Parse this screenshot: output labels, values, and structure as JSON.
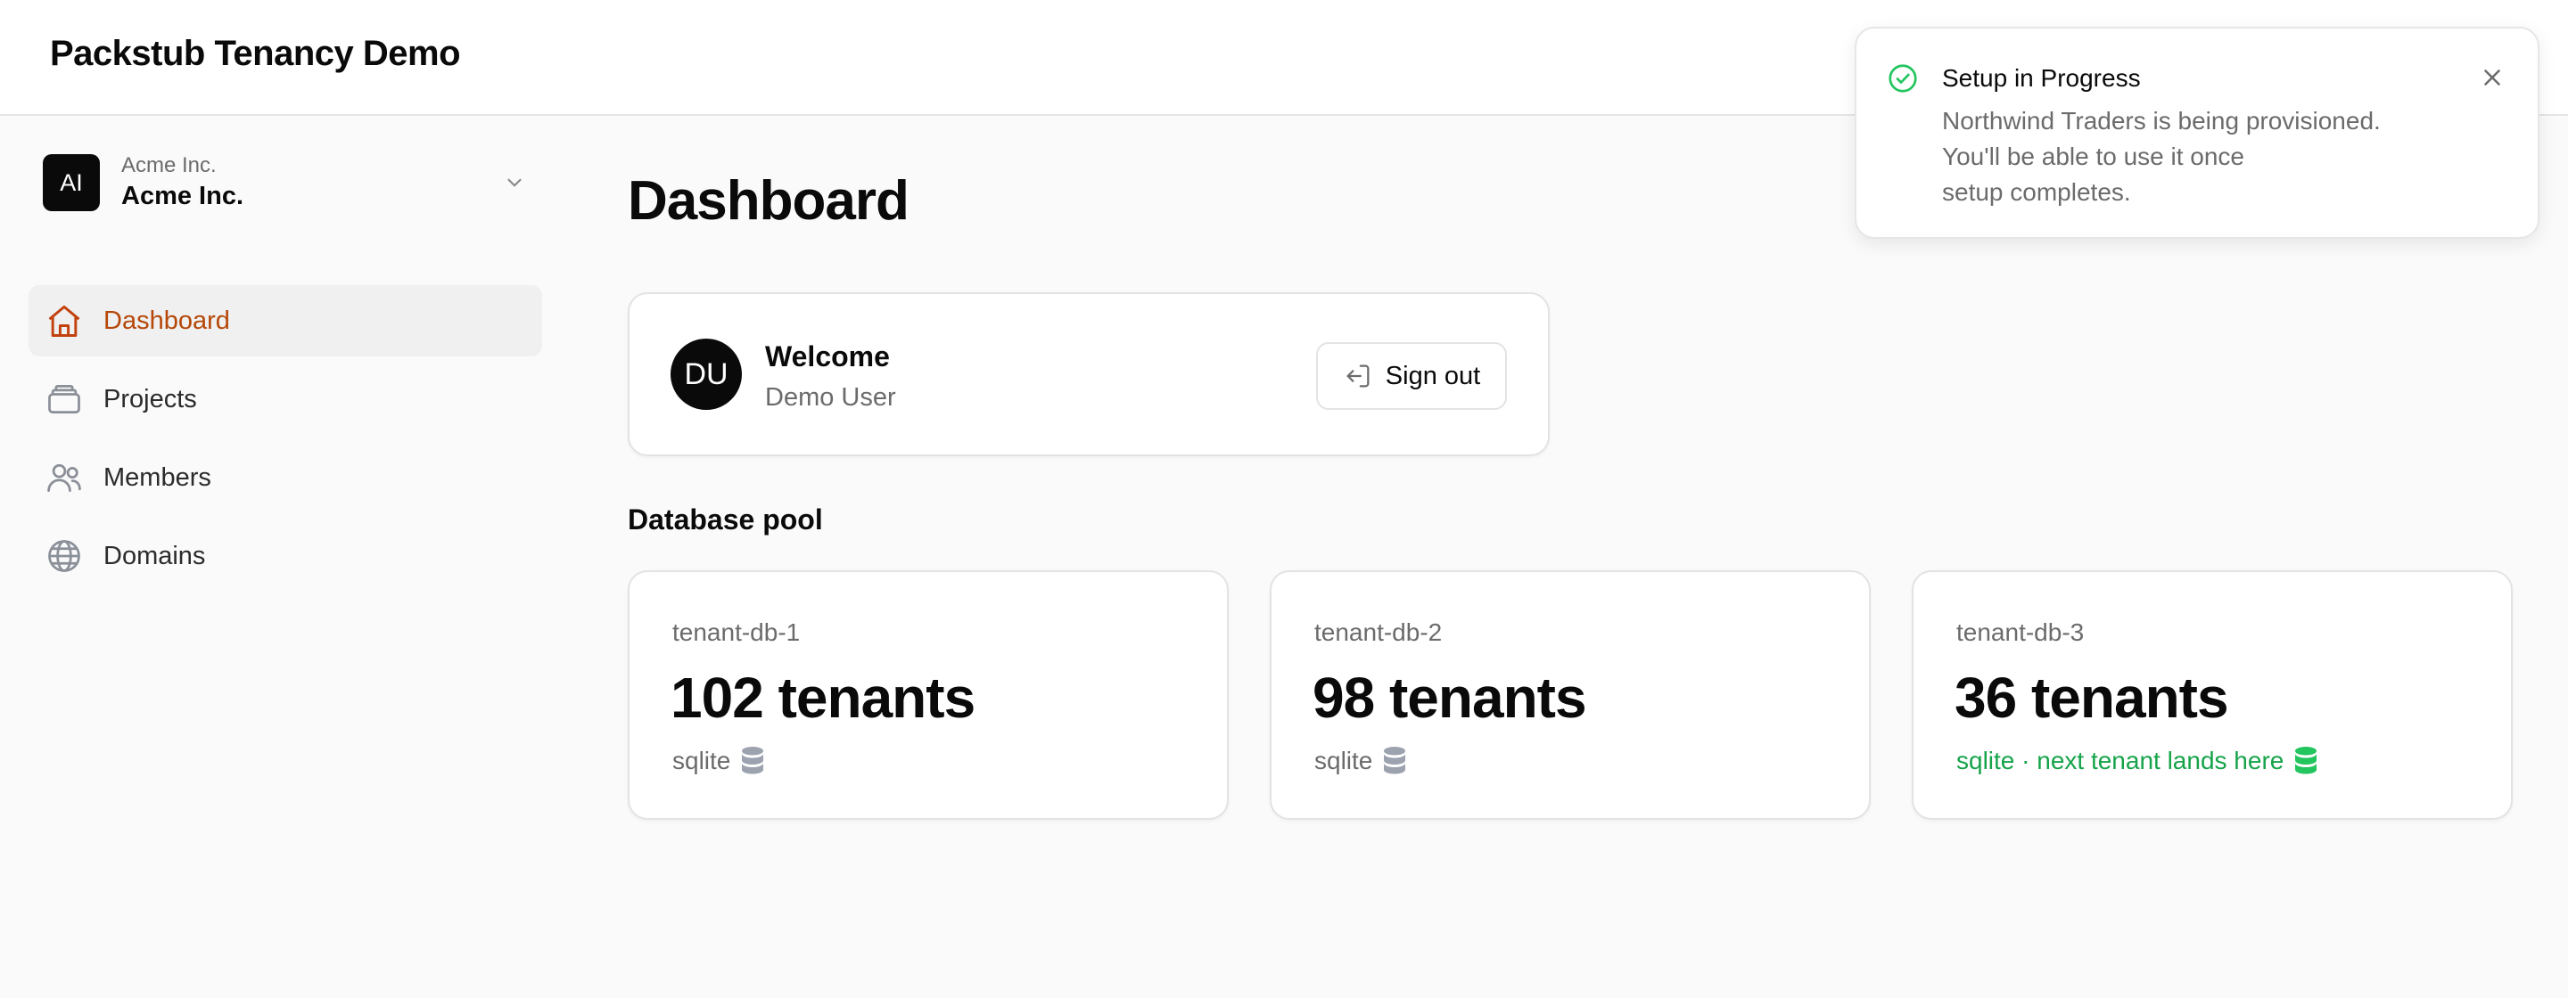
{
  "header": {
    "app_title": "Packstub Tenancy Demo"
  },
  "org": {
    "avatar_initials": "AI",
    "caption": "Acme Inc.",
    "name": "Acme Inc."
  },
  "sidebar": {
    "items": [
      {
        "label": "Dashboard",
        "icon": "home-icon",
        "active": true
      },
      {
        "label": "Projects",
        "icon": "stack-icon",
        "active": false
      },
      {
        "label": "Members",
        "icon": "users-icon",
        "active": false
      },
      {
        "label": "Domains",
        "icon": "globe-icon",
        "active": false
      }
    ]
  },
  "main": {
    "title": "Dashboard",
    "welcome": {
      "avatar_initials": "DU",
      "title": "Welcome",
      "user_name": "Demo User",
      "signout_label": "Sign out"
    },
    "pool_title": "Database pool",
    "databases": [
      {
        "name": "tenant-db-1",
        "count": "102 tenants",
        "meta": "sqlite",
        "highlight": false
      },
      {
        "name": "tenant-db-2",
        "count": "98 tenants",
        "meta": "sqlite",
        "highlight": false
      },
      {
        "name": "tenant-db-3",
        "count": "36 tenants",
        "meta": "sqlite · next tenant lands here",
        "highlight": true
      }
    ]
  },
  "toast": {
    "title": "Setup in Progress",
    "lines": [
      "Northwind Traders is being provisioned.",
      "You'll be able to use it once",
      "setup completes."
    ]
  },
  "colors": {
    "accent": "#b54708",
    "success": "#16a34a",
    "muted_icon": "#9ca3af"
  }
}
